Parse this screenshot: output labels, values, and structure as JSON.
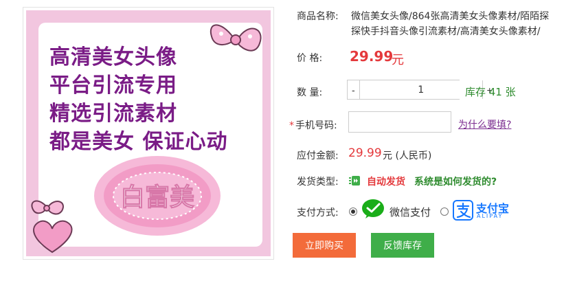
{
  "product": {
    "image": {
      "slogan_lines": [
        "高清美女头像",
        "平台引流专用",
        "精选引流素材",
        "都是美女 保证心动"
      ],
      "badge_text": "白富美"
    },
    "name_label": "商品名称:",
    "name": "微信美女头像/864张高清美女头像素材/陌陌探探快手抖音头像引流素材/高清美女头像素材/"
  },
  "price": {
    "label": "价 格:",
    "value": "29.99",
    "unit": "元"
  },
  "quantity": {
    "label": "数 量:",
    "minus": "-",
    "value": "1",
    "plus": "+",
    "stock_text": "库存 41 张"
  },
  "phone": {
    "required_mark": "*",
    "label": "手机号码:",
    "value": "",
    "placeholder": "",
    "help_link": "为什么要填?"
  },
  "payment_amount": {
    "label": "应付金额:",
    "value": "29.99",
    "unit": "元 (人民币)"
  },
  "shipping": {
    "label": "发货类型:",
    "type": "自动发货",
    "help_link": "系统是如何发货的?"
  },
  "pay_method": {
    "label": "支付方式:",
    "wechat": {
      "label": "微信支付",
      "checked": true
    },
    "alipay": {
      "name": "支付宝",
      "sub": "ALIPAY",
      "checked": false
    }
  },
  "actions": {
    "buy": "立即购买",
    "feedback": "反馈库存"
  },
  "colors": {
    "price_red": "#e4393c",
    "stock_green": "#2e8b2e",
    "buy_orange": "#f36b3a",
    "feedback_green": "#3fae49",
    "link_purple": "#7a2b8f",
    "alipay_blue": "#1677ff"
  }
}
